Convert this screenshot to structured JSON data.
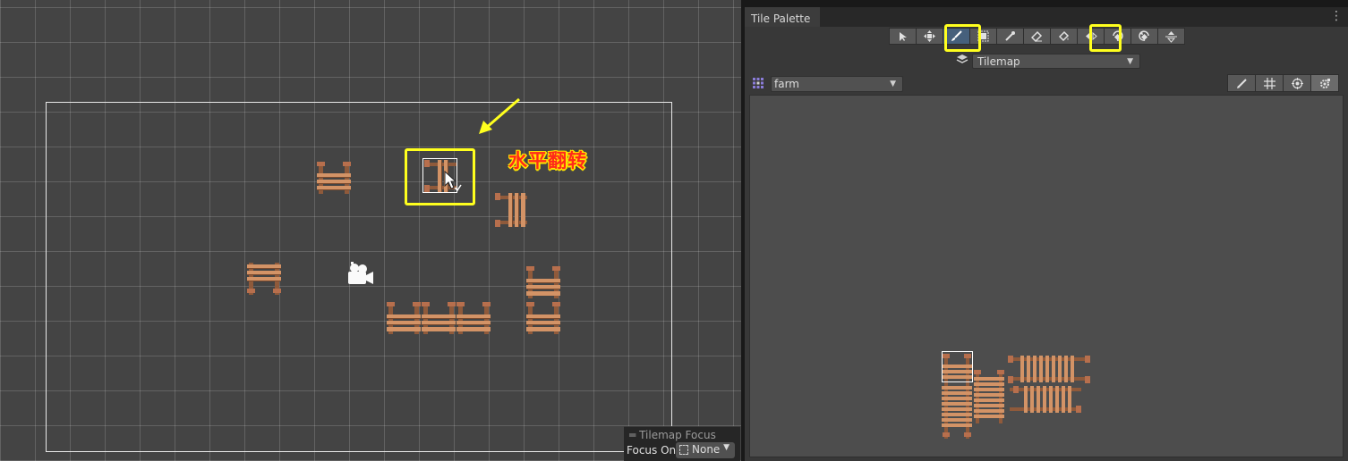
{
  "scene": {
    "annotation_text": "水平翻转",
    "focus_overlay": {
      "title": "Tilemap Focus",
      "label": "Focus On",
      "value": "None"
    }
  },
  "tile_palette": {
    "tab_title": "Tile Palette",
    "toolbar": [
      {
        "name": "select-tool",
        "icon": "cursor-arrow-icon",
        "active": false
      },
      {
        "name": "move-tool",
        "icon": "move-cross-icon",
        "active": false
      },
      {
        "name": "paint-brush-tool",
        "icon": "brush-icon",
        "active": true,
        "highlighted": true
      },
      {
        "name": "box-fill-tool",
        "icon": "box-fill-icon",
        "active": false
      },
      {
        "name": "pick-tool",
        "icon": "eyedropper-icon",
        "active": false
      },
      {
        "name": "erase-tool",
        "icon": "eraser-icon",
        "active": false
      },
      {
        "name": "flood-fill-tool",
        "icon": "paint-bucket-icon",
        "active": false
      },
      {
        "name": "flip-horizontal-tool",
        "icon": "flip-horizontal-icon",
        "active": false,
        "highlighted": true
      },
      {
        "name": "rotate-clockwise-tool",
        "icon": "rotate-cw-icon",
        "active": false
      },
      {
        "name": "rotate-counterclockwise-tool",
        "icon": "rotate-ccw-icon",
        "active": false
      },
      {
        "name": "flip-vertical-tool",
        "icon": "flip-vertical-icon",
        "active": false
      }
    ],
    "active_target": "Tilemap",
    "palette_name": "farm",
    "edit_tools": [
      "pencil-icon",
      "grid-icon",
      "gizmo-icon",
      "settings-icon"
    ]
  },
  "colors": {
    "highlight": "#ffff1e",
    "annotation_text": "#ff2a1a",
    "annotation_outline": "#ffe600",
    "fence_wood": "#c8875e",
    "scene_bg": "#444444"
  }
}
